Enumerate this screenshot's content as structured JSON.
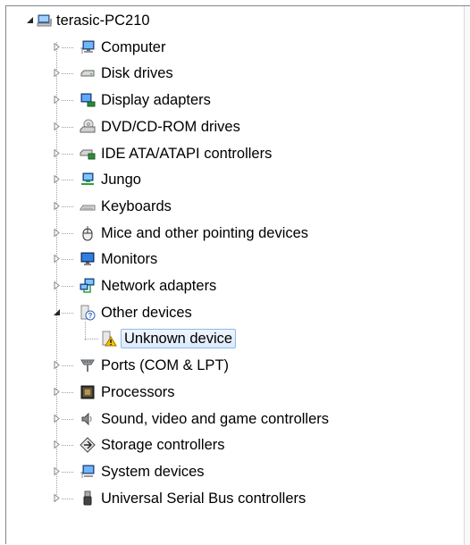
{
  "tree": {
    "root": {
      "label": "terasic-PC210",
      "icon": "computer-network-icon",
      "expanded": true
    },
    "items": [
      {
        "label": "Computer",
        "icon": "computer-icon",
        "expanded": false
      },
      {
        "label": "Disk drives",
        "icon": "disk-drive-icon",
        "expanded": false
      },
      {
        "label": "Display adapters",
        "icon": "display-adapter-icon",
        "expanded": false
      },
      {
        "label": "DVD/CD-ROM drives",
        "icon": "dvd-drive-icon",
        "expanded": false
      },
      {
        "label": "IDE ATA/ATAPI controllers",
        "icon": "ide-controller-icon",
        "expanded": false
      },
      {
        "label": "Jungo",
        "icon": "jungo-icon",
        "expanded": false
      },
      {
        "label": "Keyboards",
        "icon": "keyboard-icon",
        "expanded": false
      },
      {
        "label": "Mice and other pointing devices",
        "icon": "mouse-icon",
        "expanded": false
      },
      {
        "label": "Monitors",
        "icon": "monitor-icon",
        "expanded": false
      },
      {
        "label": "Network adapters",
        "icon": "network-adapter-icon",
        "expanded": false
      },
      {
        "label": "Other devices",
        "icon": "other-devices-icon",
        "expanded": true,
        "children": [
          {
            "label": "Unknown device",
            "icon": "unknown-device-warning-icon",
            "selected": true
          }
        ]
      },
      {
        "label": "Ports (COM & LPT)",
        "icon": "port-icon",
        "expanded": false
      },
      {
        "label": "Processors",
        "icon": "processor-icon",
        "expanded": false
      },
      {
        "label": "Sound, video and game controllers",
        "icon": "speaker-icon",
        "expanded": false
      },
      {
        "label": "Storage controllers",
        "icon": "storage-controller-icon",
        "expanded": false
      },
      {
        "label": "System devices",
        "icon": "system-devices-icon",
        "expanded": false
      },
      {
        "label": "Universal Serial Bus controllers",
        "icon": "usb-icon",
        "expanded": false
      }
    ]
  },
  "colors": {
    "selection_border": "#8fb9ea",
    "selection_fill": "#dceafc",
    "frame_border": "#828790"
  }
}
